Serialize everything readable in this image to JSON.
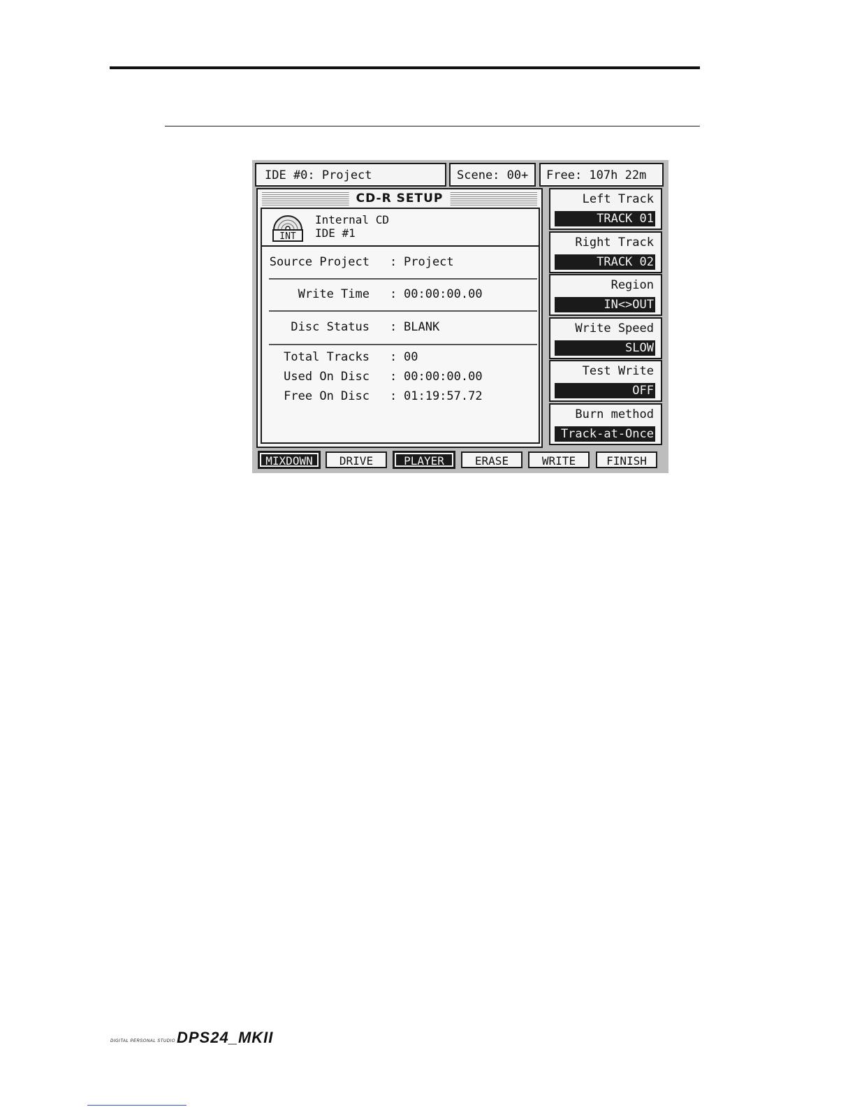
{
  "header": {
    "drive": "IDE #0: Project",
    "scene": "Scene: 00+",
    "free": "Free: 107h 22m"
  },
  "panel": {
    "title": "CD-R SETUP",
    "drive_icon_text": "INT",
    "drive_name": "Internal CD",
    "drive_id": "IDE #1",
    "rows": [
      {
        "label": "Source Project",
        "value": "Project"
      },
      {
        "label": "Write Time",
        "value": "00:00:00.00"
      },
      {
        "label": "Disc Status",
        "value": "BLANK"
      },
      {
        "label": "Total Tracks",
        "value": "00"
      },
      {
        "label": "Used On Disc",
        "value": "00:00:00.00"
      },
      {
        "label": "Free On Disc",
        "value": "01:19:57.72"
      }
    ]
  },
  "side": [
    {
      "label": "Left Track",
      "value": "TRACK 01"
    },
    {
      "label": "Right Track",
      "value": "TRACK 02"
    },
    {
      "label": "Region",
      "value": "IN<>OUT"
    },
    {
      "label": "Write Speed",
      "value": "SLOW"
    },
    {
      "label": "Test Write",
      "value": "OFF"
    },
    {
      "label": "Burn method",
      "value": "Track-at-Once"
    }
  ],
  "softkeys": [
    {
      "label": "MIXDOWN",
      "active": true
    },
    {
      "label": "DRIVE",
      "active": false
    },
    {
      "label": "PLAYER",
      "active": true
    },
    {
      "label": "ERASE",
      "active": false
    },
    {
      "label": "WRITE",
      "active": false
    },
    {
      "label": "FINISH",
      "active": false
    }
  ],
  "footer": {
    "subtitle": "DIGITAL PERSONAL STUDIO",
    "logo": "DPS24_MKII"
  }
}
